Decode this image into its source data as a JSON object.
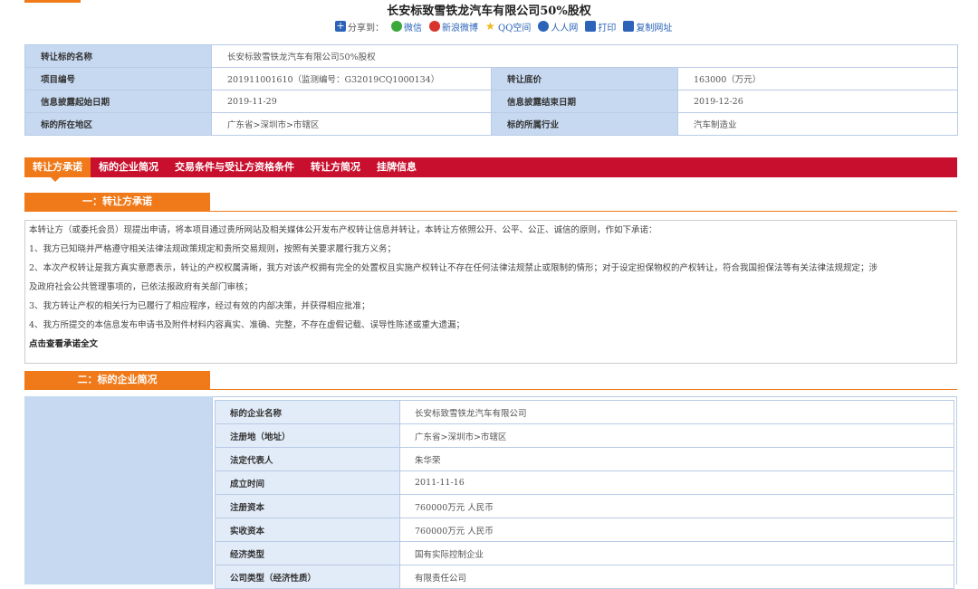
{
  "title": "长安标致雪铁龙汽车有限公司50%股权",
  "share": {
    "label": "分享到：",
    "items": [
      {
        "label": "微信",
        "icon": "wechat-icon",
        "color": "#3aa83a"
      },
      {
        "label": "新浪微博",
        "icon": "weibo-icon",
        "color": "#d9342b"
      },
      {
        "label": "QQ空间",
        "icon": "qzone-icon",
        "color": "#f2b71a"
      },
      {
        "label": "人人网",
        "icon": "renren-icon",
        "color": "#2a63b8"
      },
      {
        "label": "打印",
        "icon": "print-icon",
        "color": "#2a63b8"
      },
      {
        "label": "复制网址",
        "icon": "copy-icon",
        "color": "#2a63b8"
      }
    ]
  },
  "info": {
    "name_label": "转让标的名称",
    "name_value": "长安标致雪铁龙汽车有限公司50%股权",
    "project_no_label": "项目编号",
    "project_no_value": "201911001610（监测编号：G32019CQ1000134）",
    "reserve_price_label": "转让底价",
    "reserve_price_value": "163000（万元）",
    "start_date_label": "信息披露起始日期",
    "start_date_value": "2019-11-29",
    "end_date_label": "信息披露结束日期",
    "end_date_value": "2019-12-26",
    "region_label": "标的所在地区",
    "region_value": "广东省>深圳市>市辖区",
    "industry_label": "标的所属行业",
    "industry_value": "汽车制造业"
  },
  "tabs": [
    "转让方承诺",
    "标的企业简况",
    "交易条件与受让方资格条件",
    "转让方简况",
    "挂牌信息"
  ],
  "section1": {
    "title": "一：转让方承诺",
    "lines": [
      "本转让方（或委托会员）现提出申请，将本项目通过贵所网站及相关媒体公开发布产权转让信息并转让，本转让方依照公开、公平、公正、诚信的原则，作如下承诺：",
      "1、我方已知晓并严格遵守相关法律法规政策规定和贵所交易规则，按照有关要求履行我方义务；",
      "2、本次产权转让是我方真实意愿表示，转让的产权权属清晰，我方对该产权拥有完全的处置权且实施产权转让不存在任何法律法规禁止或限制的情形；对于设定担保物权的产权转让，符合我国担保法等有关法律法规规定；涉",
      "及政府社会公共管理事项的，已依法报政府有关部门审核；",
      "3、我方转让产权的相关行为已履行了相应程序，经过有效的内部决策，并获得相应批准；",
      "4、我方所提交的本信息发布申请书及附件材料内容真实、准确、完整，不存在虚假记载、误导性陈述或重大遗漏；"
    ],
    "more_link": "点击查看承诺全文"
  },
  "section2": {
    "title": "二：标的企业简况",
    "rows": [
      {
        "label": "标的企业名称",
        "value": "长安标致雪铁龙汽车有限公司"
      },
      {
        "label": "注册地（地址）",
        "value": "广东省>深圳市>市辖区"
      },
      {
        "label": "法定代表人",
        "value": "朱华荣"
      },
      {
        "label": "成立时间",
        "value": "2011-11-16"
      },
      {
        "label": "注册资本",
        "value": "760000万元 人民币"
      },
      {
        "label": "实收资本",
        "value": "760000万元 人民币"
      },
      {
        "label": "经济类型",
        "value": "国有实际控制企业"
      },
      {
        "label": "公司类型（经济性质）",
        "value": "有限责任公司"
      }
    ]
  }
}
